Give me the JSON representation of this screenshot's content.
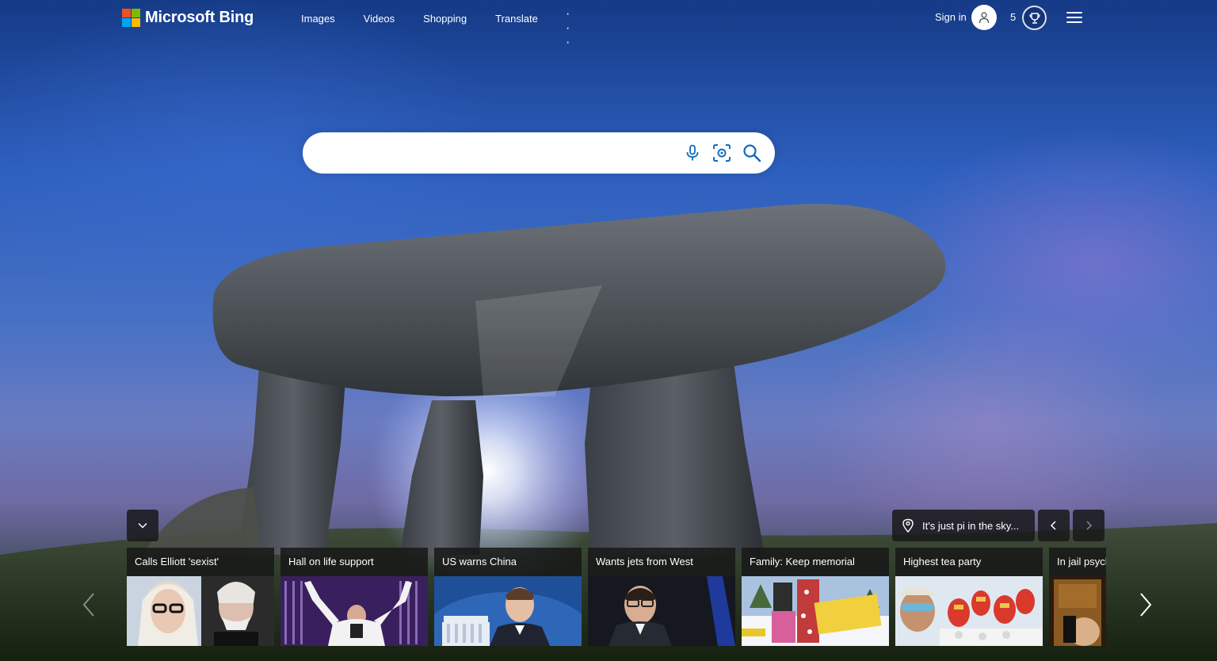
{
  "brand": {
    "name": "Microsoft Bing"
  },
  "nav": {
    "items": [
      {
        "label": "Images"
      },
      {
        "label": "Videos"
      },
      {
        "label": "Shopping"
      },
      {
        "label": "Translate"
      }
    ],
    "more_label": "· · ·"
  },
  "account": {
    "sign_in_label": "Sign in",
    "rewards_points": "5"
  },
  "search": {
    "value": "",
    "placeholder": ""
  },
  "image_of_day": {
    "caption": "It's just pi in the sky..."
  },
  "news": [
    {
      "title": "Calls Elliott 'sexist'"
    },
    {
      "title": "Hall on life support"
    },
    {
      "title": "US warns China"
    },
    {
      "title": "Wants jets from West"
    },
    {
      "title": "Family: Keep memorial"
    },
    {
      "title": "Highest tea party"
    },
    {
      "title": "In jail psychiatric"
    }
  ],
  "colors": {
    "accent_blue": "#0f6cbd",
    "logo_red": "#f25022",
    "logo_green": "#7fba00",
    "logo_blue": "#00a4ef",
    "logo_yellow": "#ffb900"
  },
  "icons": [
    "microphone-icon",
    "visual-search-icon",
    "search-icon",
    "user-icon",
    "trophy-icon",
    "menu-icon",
    "location-pin-icon",
    "chevron-down-icon",
    "chevron-left-icon",
    "chevron-right-icon"
  ]
}
